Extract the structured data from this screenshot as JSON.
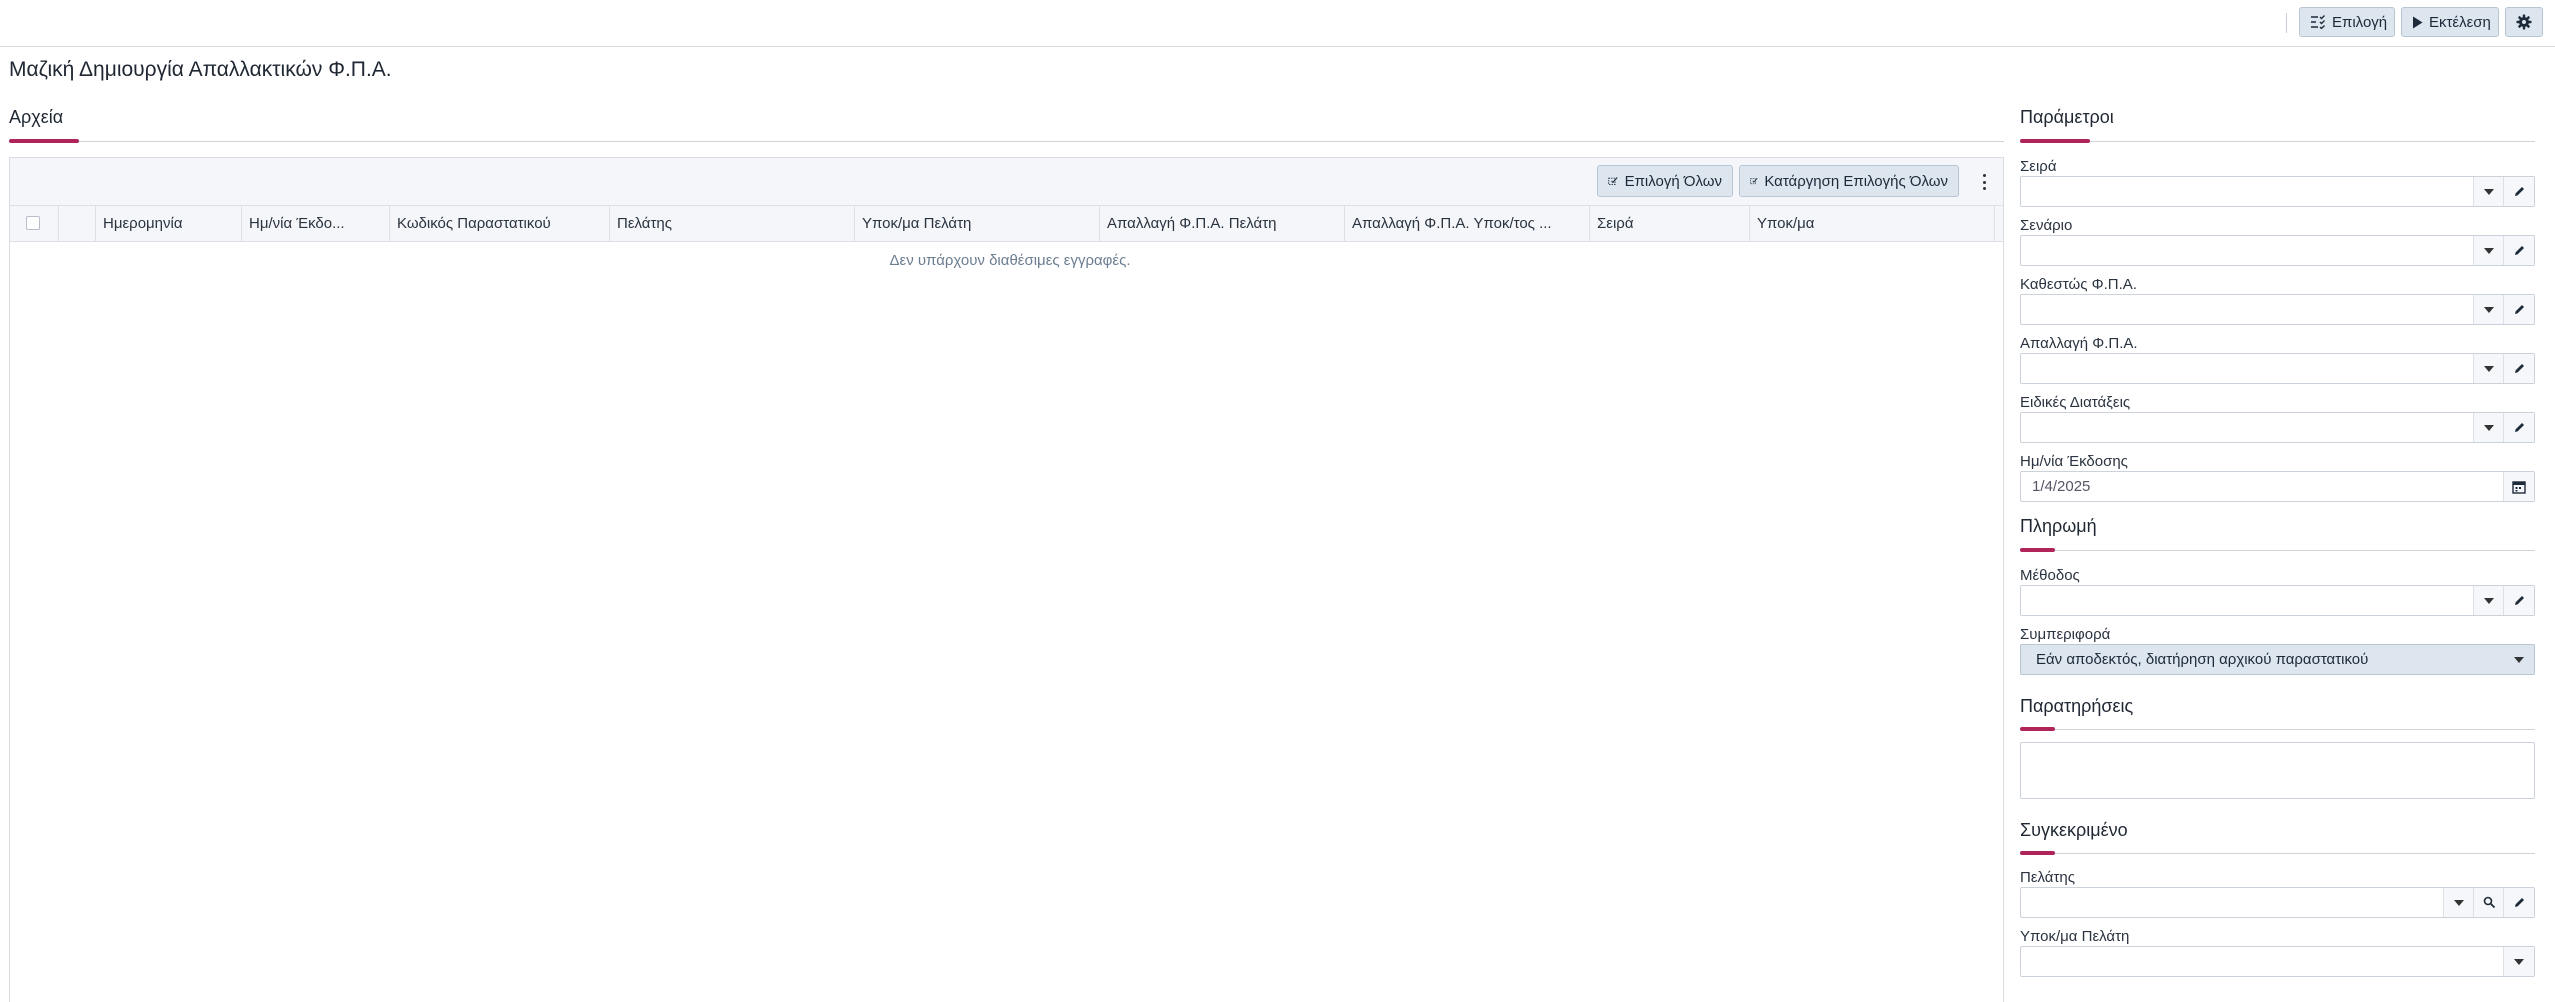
{
  "toolbar": {
    "select_label": "Επιλογή",
    "run_label": "Εκτέλεση"
  },
  "page_title": "Μαζική Δημιουργία Απαλλακτικών Φ.Π.Α.",
  "files_section": {
    "title": "Αρχεία",
    "select_all_label": "Επιλογή Όλων",
    "deselect_all_label": "Κατάργηση Επιλογής Όλων",
    "columns": [
      "Ημερομηνία",
      "Ημ/νία Έκδο...",
      "Κωδικός Παραστατικού",
      "Πελάτης",
      "Υποκ/μα Πελάτη",
      "Απαλλαγή Φ.Π.Α. Πελάτη",
      "Απαλλαγή Φ.Π.Α. Υποκ/τος ...",
      "Σειρά",
      "Υποκ/μα"
    ],
    "empty_message": "Δεν υπάρχουν διαθέσιμες εγγραφές."
  },
  "parameters": {
    "title": "Παράμετροι",
    "fields": {
      "series": {
        "label": "Σειρά",
        "value": ""
      },
      "scenario": {
        "label": "Σενάριο",
        "value": ""
      },
      "vat_status": {
        "label": "Καθεστώς Φ.Π.Α.",
        "value": ""
      },
      "vat_exemption": {
        "label": "Απαλλαγή Φ.Π.Α.",
        "value": ""
      },
      "special_provisions": {
        "label": "Ειδικές Διατάξεις",
        "value": ""
      },
      "issue_date": {
        "label": "Ημ/νία Έκδοσης",
        "value": "1/4/2025"
      }
    }
  },
  "payment": {
    "title": "Πληρωμή",
    "method": {
      "label": "Μέθοδος",
      "value": ""
    },
    "behavior": {
      "label": "Συμπεριφορά",
      "value": "Εάν αποδεκτός, διατήρηση αρχικού παραστατικού"
    }
  },
  "notes": {
    "title": "Παρατηρήσεις",
    "value": ""
  },
  "specific": {
    "title": "Συγκεκριμένο",
    "customer": {
      "label": "Πελάτης",
      "value": ""
    },
    "customer_branch": {
      "label": "Υποκ/μα Πελάτη",
      "value": ""
    }
  },
  "colors": {
    "accent": "#b0245a",
    "button_bg": "#dde5ef",
    "grid_header_bg": "#f4f6f9"
  }
}
